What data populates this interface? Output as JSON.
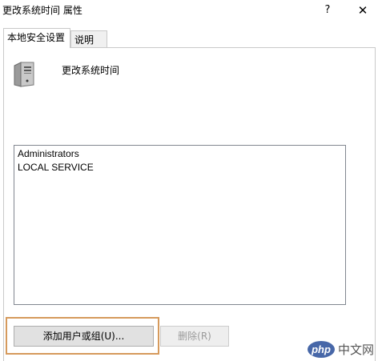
{
  "window": {
    "title": "更改系统时间 属性",
    "help_glyph": "?",
    "close_glyph": "✕"
  },
  "tabs": [
    {
      "label": "本地安全设置",
      "active": true
    },
    {
      "label": "说明",
      "active": false
    }
  ],
  "policy": {
    "icon": "server-icon",
    "name": "更改系统时间"
  },
  "accounts": [
    "Administrators",
    "LOCAL SERVICE"
  ],
  "buttons": {
    "add_label": "添加用户或组(U)...",
    "remove_label": "删除(R)"
  },
  "watermark": {
    "logo": "php",
    "text": "中文网"
  },
  "colors": {
    "highlight_border": "#d69a5c",
    "watermark_logo": "#4767a8"
  }
}
